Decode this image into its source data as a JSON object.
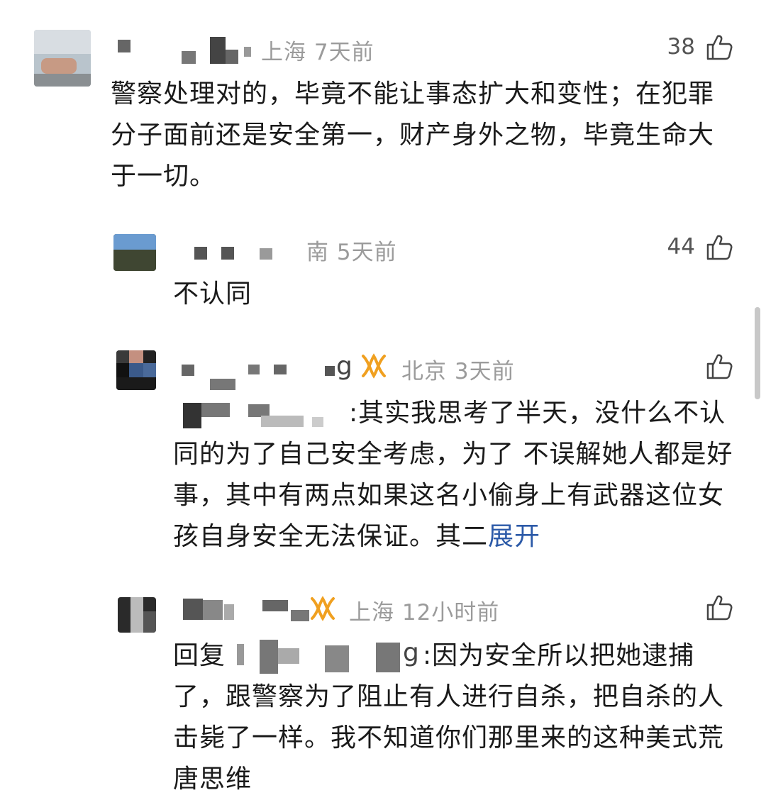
{
  "comments": [
    {
      "location": "上海",
      "time": "7天前",
      "likes": "38",
      "text": "警察处理对的，毕竟不能让事态扩大和变性；在犯罪分子面前还是安全第一，财产身外之物，毕竟生命大于一切。"
    },
    {
      "location": "南",
      "time": "5天前",
      "likes": "44",
      "text": "不认同"
    },
    {
      "location": "北京",
      "time": "3天前",
      "name_tail": "g",
      "text": ":其实我思考了半天，没什么不认同的为了自己安全考虑，为了 不误解她人都是好事，其中有两点如果这名小偷身上有武器这位女孩自身安全无法保证。其二",
      "expand_label": "展开"
    },
    {
      "location": "上海",
      "time": "12小时前",
      "reply_prefix": "回复",
      "reply_name_tail": "g",
      "text": ":因为安全所以把她逮捕了，跟警察为了阻止有人进行自杀，把自杀的人击毙了一样。我不知道你们那里来的这种美式荒唐思维"
    }
  ],
  "icons": {
    "like": "thumbs-up-icon",
    "vip": "vip-badge-icon"
  },
  "colors": {
    "meta": "#9b9b9b",
    "text": "#1a1a1a",
    "link": "#2c5aa8",
    "vip": "#f0a020"
  }
}
